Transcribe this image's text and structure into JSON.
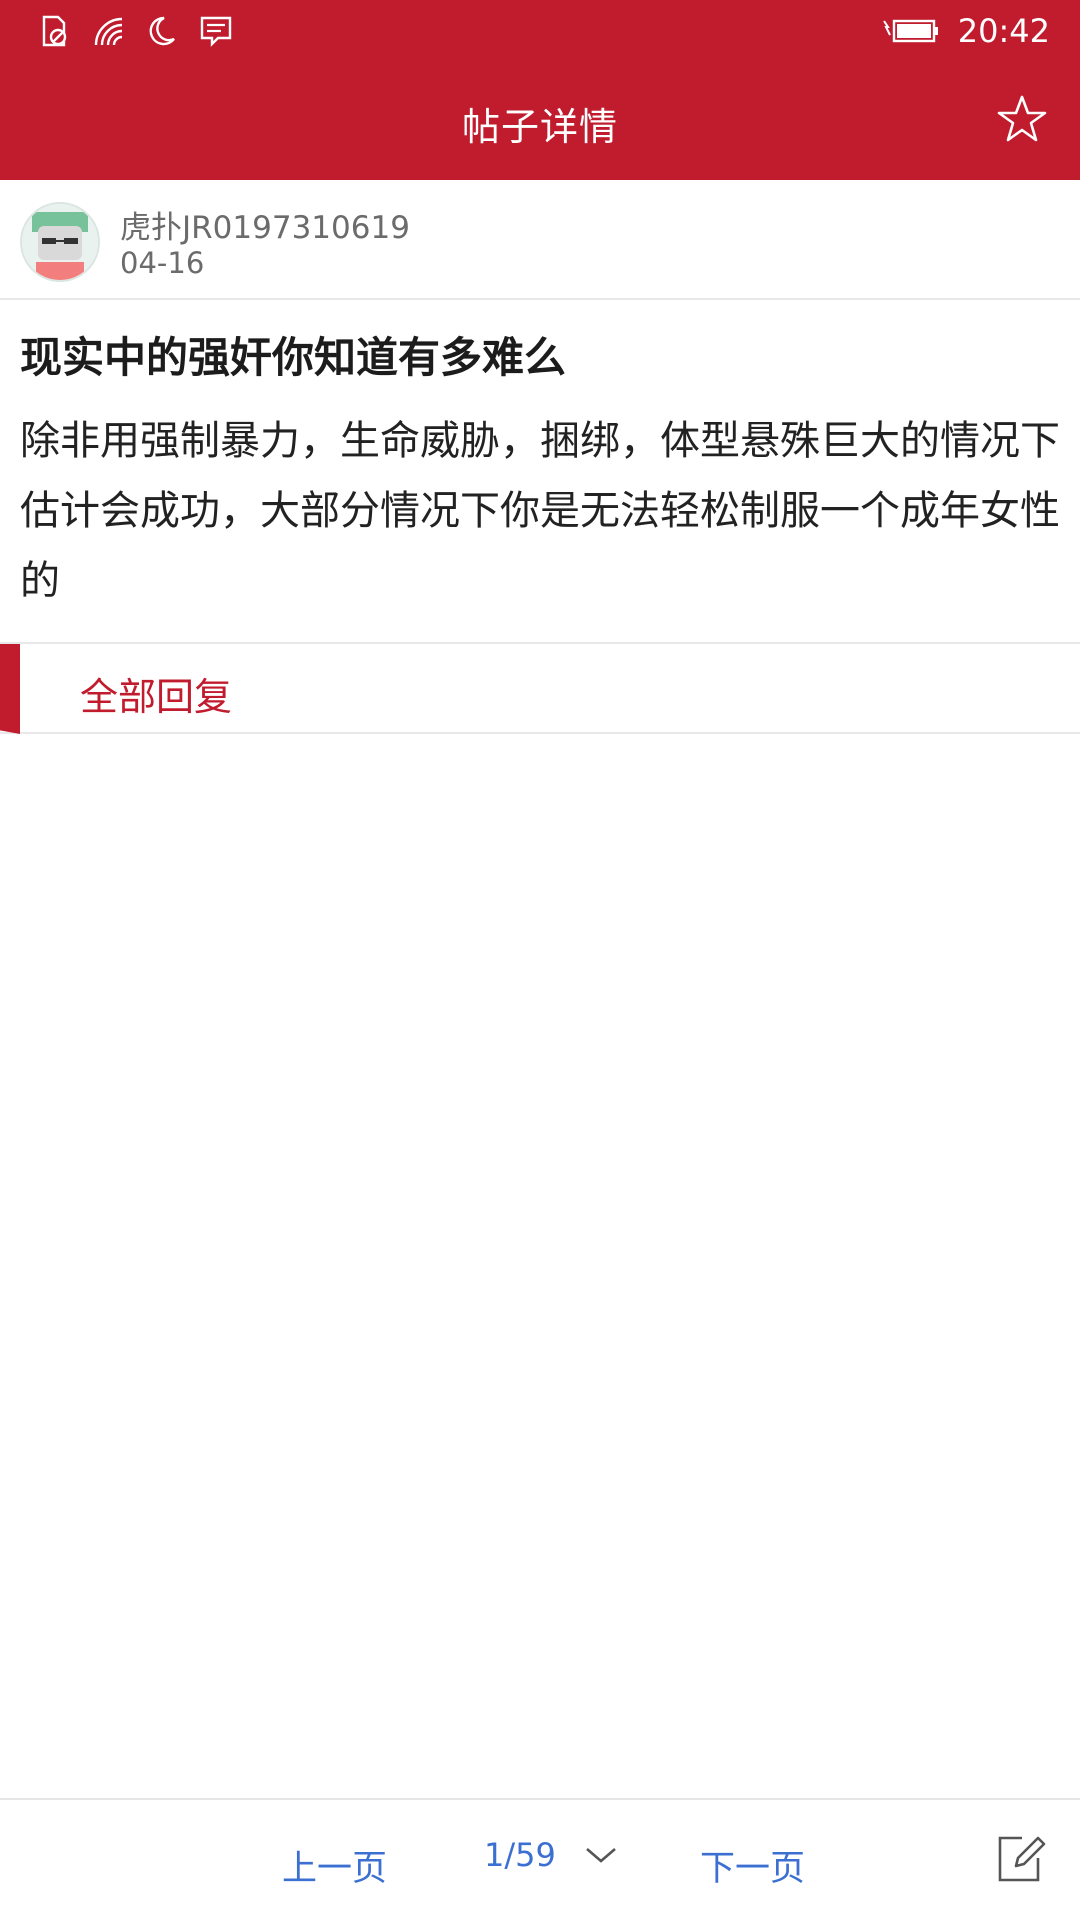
{
  "status_bar": {
    "time": "20:42",
    "icons": [
      "sim-blocked-icon",
      "wifi-icon",
      "moon-icon",
      "message-icon",
      "battery-charging-icon"
    ]
  },
  "header": {
    "title": "帖子详情",
    "favorite_icon": "star-outline-icon"
  },
  "author": {
    "name": "虎扑JR0197310619",
    "date": "04-16",
    "avatar_icon": "avatar"
  },
  "post": {
    "title": "现实中的强奸你知道有多难么",
    "body": "除非用强制暴力，生命威胁，捆绑，体型悬殊巨大的情况下估计会成功，大部分情况下你是无法轻松制服一个成年女性的"
  },
  "replies": {
    "label": "全部回复"
  },
  "pager": {
    "prev_label": "上一页",
    "current": "1/59",
    "next_label": "下一页",
    "compose_icon": "compose-icon"
  },
  "colors": {
    "brand": "#c11c2e",
    "link": "#3b6fd1"
  }
}
